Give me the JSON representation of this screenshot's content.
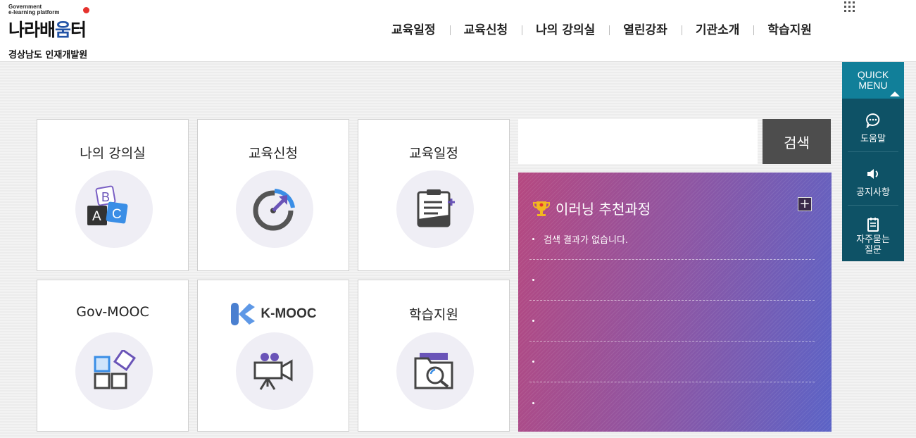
{
  "header": {
    "logo_gov_line1": "Government",
    "logo_gov_line2": "e-learning platform",
    "logo_brand_a": "나라배",
    "logo_brand_b": "움",
    "logo_brand_c": "터",
    "org_name": "경상남도 인재개발원"
  },
  "nav": [
    "교육일정",
    "교육신청",
    "나의 강의실",
    "열린강좌",
    "기관소개",
    "학습지원"
  ],
  "tiles": [
    {
      "label": "나의 강의실",
      "icon": "abc-blocks-icon"
    },
    {
      "label": "교육신청",
      "icon": "target-arrow-icon"
    },
    {
      "label": "교육일정",
      "icon": "clipboard-plus-icon"
    },
    {
      "label": "Gov-MOOC",
      "icon": "shapes-grid-icon"
    },
    {
      "label": "K-MOOC",
      "icon": "video-camera-icon"
    },
    {
      "label": "학습지원",
      "icon": "folder-search-icon"
    }
  ],
  "search": {
    "placeholder": "",
    "button_label": "검색"
  },
  "recommend": {
    "title": "이러닝 추천과정",
    "plus": "+",
    "items": [
      "검색 결과가 없습니다.",
      "",
      "",
      "",
      ""
    ]
  },
  "quick_menu": {
    "title_line1": "QUICK",
    "title_line2": "MENU",
    "items": [
      {
        "label": "도움말",
        "icon": "chat-bubble-icon"
      },
      {
        "label": "공지사항",
        "icon": "speaker-icon"
      },
      {
        "label_line1": "자주묻는",
        "label_line2": "질문",
        "icon": "notepad-icon"
      }
    ]
  },
  "colors": {
    "accent_teal": "#117f99",
    "quick_dark": "#0e5266",
    "search_btn": "#4d4d4d",
    "reco_from": "#b54880",
    "reco_to": "#5b63c6"
  }
}
